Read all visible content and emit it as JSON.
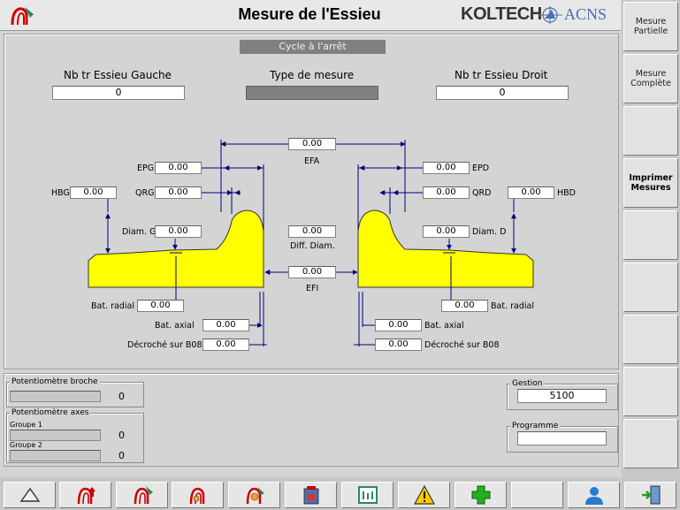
{
  "header": {
    "title": "Mesure de l'Essieu",
    "brand_left": "KOLTECH",
    "brand_right": "ACNS",
    "status": "Cycle à l'arrêt"
  },
  "top_fields": {
    "nb_tr_gauche_label": "Nb tr Essieu Gauche",
    "nb_tr_gauche_value": "0",
    "type_mesure_label": "Type de mesure",
    "nb_tr_droit_label": "Nb tr Essieu Droit",
    "nb_tr_droit_value": "0"
  },
  "measures": {
    "efa": "0.00",
    "efa_label": "EFA",
    "epg": "0.00",
    "epg_label": "EPG",
    "epd": "0.00",
    "epd_label": "EPD",
    "hbg": "0.00",
    "hbg_label": "HBG",
    "qrg": "0.00",
    "qrg_label": "QRG",
    "qrd": "0.00",
    "qrd_label": "QRD",
    "hbd": "0.00",
    "hbd_label": "HBD",
    "diam_g": "0.00",
    "diam_g_label": "Diam. G",
    "diam_d": "0.00",
    "diam_d_label": "Diam. D",
    "diff_diam": "0.00",
    "diff_diam_label": "Diff. Diam.",
    "efi": "0.00",
    "efi_label": "EFI",
    "bat_radial_g": "0.00",
    "bat_radial_d": "0.00",
    "bat_radial_label": "Bat. radial",
    "bat_axial_g": "0.00",
    "bat_axial_d": "0.00",
    "bat_axial_label": "Bat. axial",
    "decroche_g": "0.00",
    "decroche_d": "0.00",
    "decroche_label": "Décroché sur B08"
  },
  "potentiometers": {
    "broche_title": "Potentiomètre broche",
    "broche_value": "0",
    "axes_title": "Potentiomètre axes",
    "groupe1_label": "Groupe 1",
    "groupe1_value": "0",
    "groupe2_label": "Groupe 2",
    "groupe2_value": "0"
  },
  "gestion": {
    "title": "Gestion",
    "value": "5100"
  },
  "programme": {
    "title": "Programme",
    "value": ""
  },
  "side_buttons": [
    {
      "label": "Mesure Partielle"
    },
    {
      "label": "Mesure Complète"
    },
    {
      "label": ""
    },
    {
      "label": "Imprimer Mesures"
    },
    {
      "label": ""
    },
    {
      "label": ""
    },
    {
      "label": ""
    },
    {
      "label": ""
    },
    {
      "label": ""
    }
  ],
  "bottom_icons": [
    "triangle-up-icon",
    "spindle-up-icon",
    "tool-icon",
    "spindle-gear-icon",
    "probe-icon",
    "machine-icon",
    "counter-icon",
    "warning-icon",
    "add-icon",
    "",
    "user-icon",
    "exit-icon"
  ],
  "colors": {
    "wheel": "#ffff00",
    "dim_line": "#00007f",
    "panel": "#d4d4d4"
  }
}
